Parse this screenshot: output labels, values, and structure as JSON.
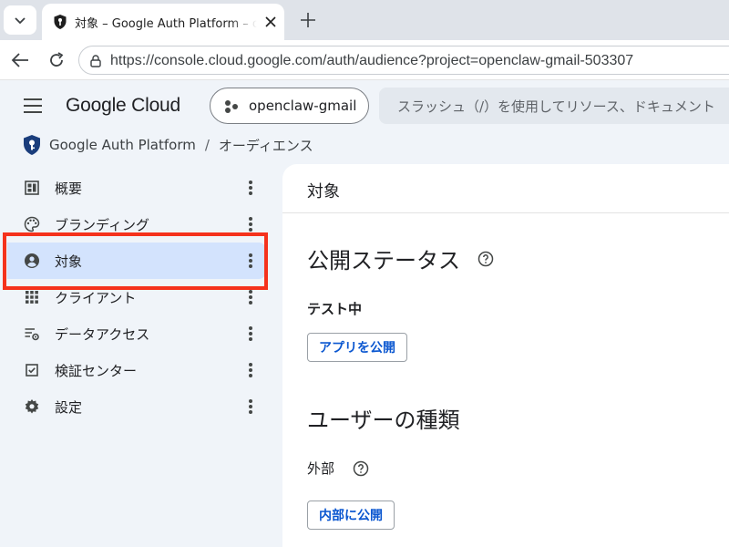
{
  "browser": {
    "tab_title": "対象 – Google Auth Platform – openclaw-gmail-503307",
    "url": "https://console.cloud.google.com/auth/audience?project=openclaw-gmail-503307",
    "icons": [
      "tab-list-icon",
      "shield-key-favicon",
      "close-icon",
      "plus-icon",
      "back-arrow-icon",
      "reload-icon",
      "site-info-icon"
    ]
  },
  "header": {
    "logo_text": "Google Cloud",
    "project_name": "openclaw-gmail",
    "search_placeholder": "スラッシュ（/）を使用してリソース、ドキュメント"
  },
  "breadcrumb": {
    "product": "Google Auth Platform",
    "separator": "/",
    "current": "オーディエンス"
  },
  "sidebar": {
    "items": [
      {
        "label": "概要",
        "icon": "dashboard-icon"
      },
      {
        "label": "ブランディング",
        "icon": "palette-icon"
      },
      {
        "label": "対象",
        "icon": "account-circle-icon",
        "active": true
      },
      {
        "label": "クライアント",
        "icon": "grid-icon"
      },
      {
        "label": "データアクセス",
        "icon": "list-settings-icon"
      },
      {
        "label": "検証センター",
        "icon": "checkbox-icon"
      },
      {
        "label": "設定",
        "icon": "gear-icon"
      }
    ]
  },
  "main": {
    "title": "対象",
    "publish_status_heading": "公開ステータス",
    "publish_status_value": "テスト中",
    "publish_button": "アプリを公開",
    "user_type_heading": "ユーザーの種類",
    "user_type_value": "外部",
    "make_internal_button": "内部に公開"
  },
  "colors": {
    "highlight": "#f5321c",
    "active_nav": "#d3e3fd",
    "link_blue": "#0b57d0",
    "console_bg": "#f0f4f9"
  }
}
